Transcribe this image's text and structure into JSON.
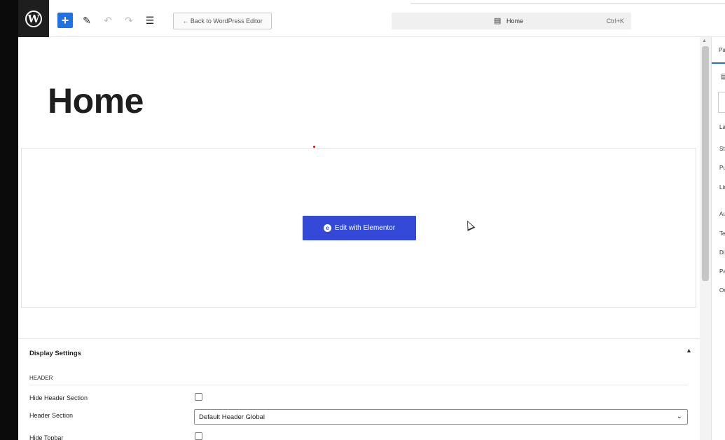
{
  "toolbar": {
    "logo_glyph": "W",
    "add_glyph": "+",
    "pen_glyph": "✎",
    "undo_glyph": "↶",
    "redo_glyph": "↷",
    "list_glyph": "☰",
    "back_label": "← Back to WordPress Editor",
    "command": {
      "icon": "▤",
      "title": "Home",
      "shortcut": "Ctrl+K"
    }
  },
  "editor": {
    "page_title": "Home",
    "edit_button": {
      "icon": "e",
      "label": "Edit with Elementor"
    }
  },
  "meta_box": {
    "title": "Display Settings",
    "toggle_glyph": "▲",
    "section_label": "HEADER",
    "fields": {
      "hide_header": "Hide Header Section",
      "header_section": "Header Section",
      "header_section_value": "Default Header Global",
      "hide_topbar": "Hide Topbar"
    }
  },
  "sidebar": {
    "tab": "Pa",
    "items": [
      "La",
      "St",
      "Pu",
      "Lin",
      "Au",
      "Te",
      "Di",
      "Pa",
      "Or"
    ]
  },
  "colors": {
    "accent": "#2271e3",
    "elementor_button": "#3449d8",
    "wp_logo_bg": "#1e1e1e"
  }
}
